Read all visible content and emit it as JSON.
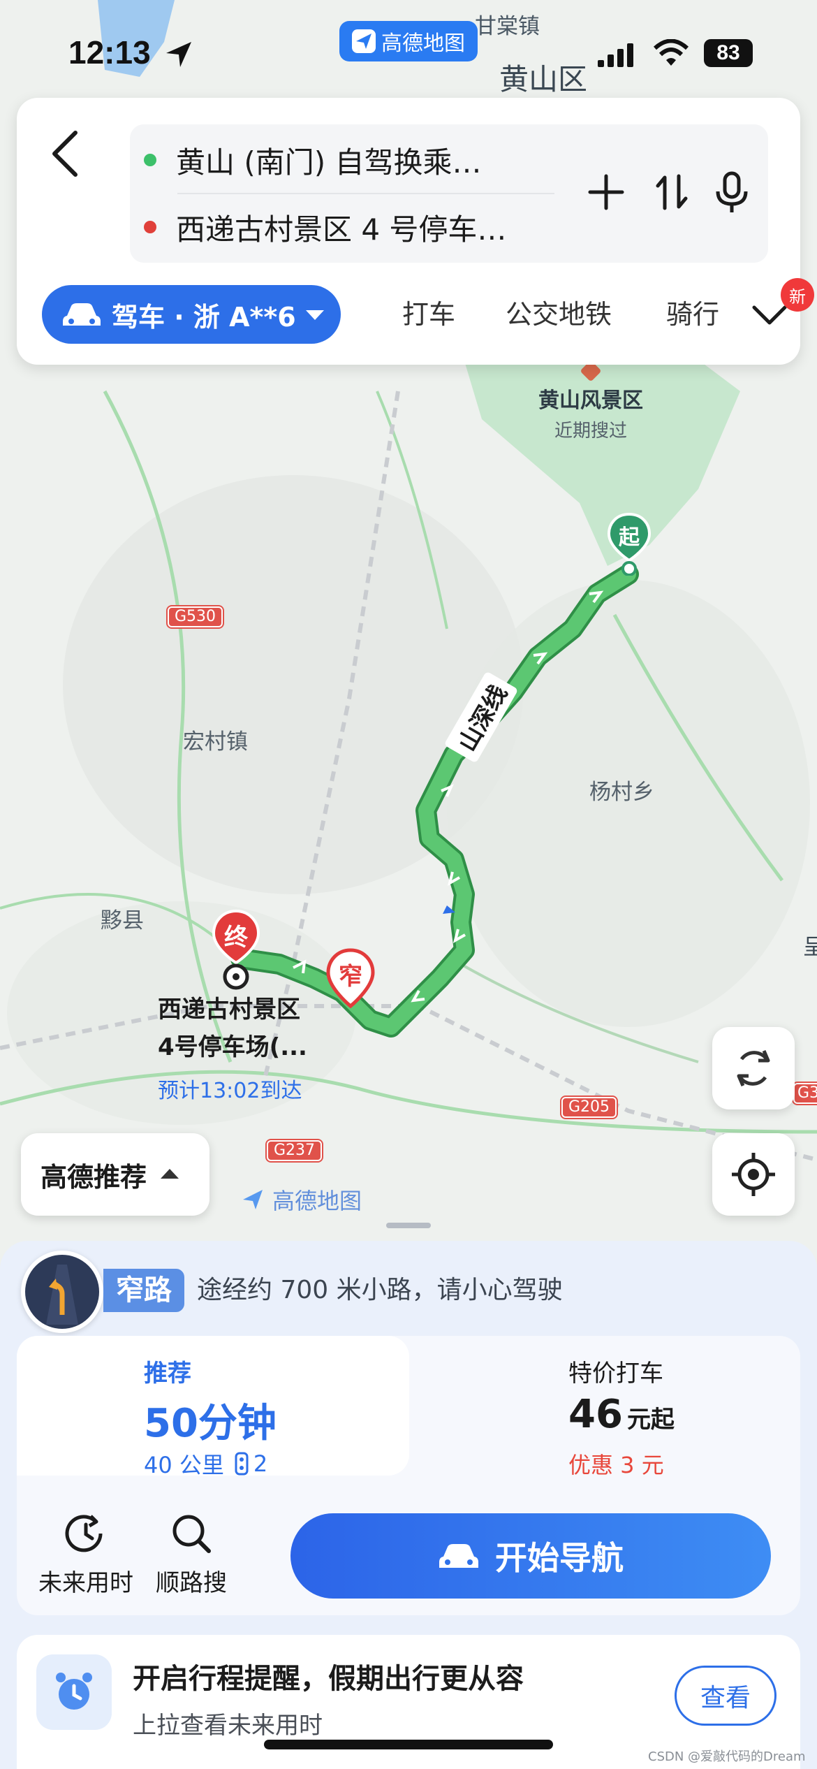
{
  "status_bar": {
    "time": "12:13",
    "app_pill": "高德地图",
    "battery": "83"
  },
  "map": {
    "labels": {
      "gantang": "甘棠镇",
      "huangshan_district": "黄山区",
      "hongcun": "宏村镇",
      "yangcun": "杨村乡",
      "yixian": "黟县",
      "scenic_name": "黄山风景区",
      "scenic_sub": "近期搜过",
      "road_name": "山深线",
      "dest_line1": "西递古村景区",
      "dest_line2": "4号停车场(...",
      "eta": "预计13:02到达",
      "watermark_logo": "高德地图",
      "edge_char": "呈"
    },
    "road_badges": {
      "g530": "G530",
      "g205": "G205",
      "g237": "G237",
      "g3": "G3"
    },
    "markers": {
      "start": "起",
      "end": "终",
      "narrow": "窄"
    }
  },
  "route_card": {
    "origin": "黄山 (南门) 自驾换乘…",
    "destination": "西递古村景区 4 号停车…",
    "modes": {
      "drive": "驾车 · 浙 A**6",
      "taxi": "打车",
      "transit": "公交地铁",
      "cycle": "骑行",
      "new_badge": "新"
    }
  },
  "map_controls": {
    "recommend": "高德推荐"
  },
  "alert": {
    "tag": "窄路",
    "text": "途经约 700 米小路，请小心驾驶"
  },
  "route_options": {
    "recommended": {
      "tag": "推荐",
      "time": "50分钟",
      "distance": "40 公里",
      "lights": "2"
    },
    "taxi": {
      "tag": "特价打车",
      "price": "46",
      "price_unit": "元起",
      "discount": "优惠 3 元"
    }
  },
  "tools": {
    "future": "未来用时",
    "along": "顺路搜"
  },
  "nav_button": "开始导航",
  "reminder": {
    "title": "开启行程提醒，假期出行更从容",
    "subtitle": "上拉查看未来用时",
    "button": "查看"
  },
  "watermark": "CSDN @爱敲代码的Dream",
  "colors": {
    "route": "#3db65a",
    "accent": "#2d6fe8",
    "start_marker": "#2f9a6a",
    "end_marker": "#e23b3b",
    "discount": "#e8473b"
  }
}
